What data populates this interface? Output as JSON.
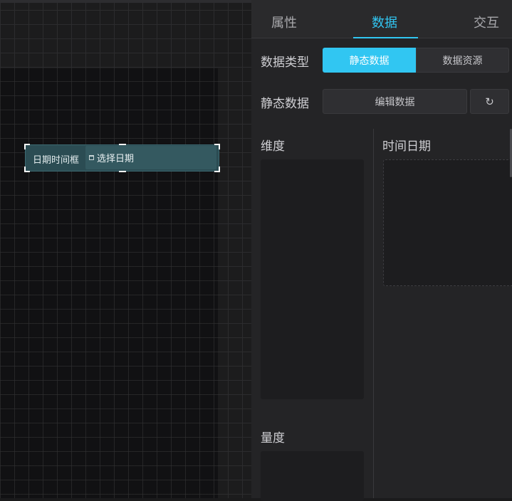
{
  "canvas": {
    "widget": {
      "label": "日期时间框",
      "input_placeholder": "选择日期",
      "input_icon": "calendar-icon"
    }
  },
  "panel": {
    "tabs": [
      {
        "label": "属性",
        "active": false
      },
      {
        "label": "数据",
        "active": true
      },
      {
        "label": "交互",
        "active": false
      }
    ],
    "data_type": {
      "label": "数据类型",
      "options": [
        "静态数据",
        "数据资源"
      ],
      "selected": "静态数据"
    },
    "static_data": {
      "label": "静态数据",
      "edit_button": "编辑数据",
      "reset_icon": "refresh-icon"
    },
    "sections": {
      "dimension": "维度",
      "datetime": "时间日期",
      "measure": "量度"
    }
  },
  "colors": {
    "accent": "#31c6f2",
    "panel_bg": "#242426",
    "canvas_bg": "#1c1c1d",
    "widget_bg": "#2b4c53"
  }
}
